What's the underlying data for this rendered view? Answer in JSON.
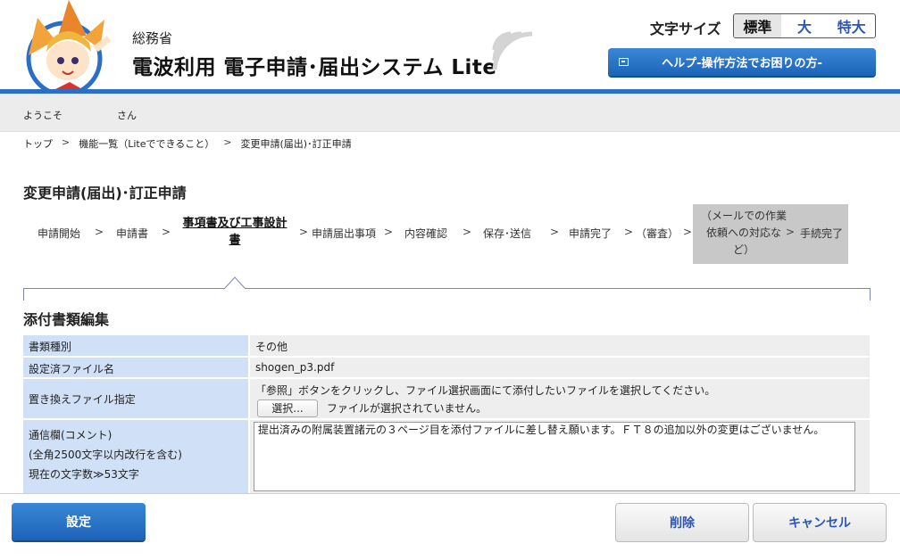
{
  "header": {
    "org_name": "総務省",
    "system_title": "電波利用 電子申請･届出システム Lite",
    "font_size_label": "文字サイズ",
    "font_size_options": [
      "標準",
      "大",
      "特大"
    ],
    "font_size_selected": "標準",
    "help_button": "ヘルプ-操作方法でお困りの方-"
  },
  "welcome": {
    "prefix": "ようこそ",
    "suffix": "さん"
  },
  "breadcrumb": [
    "トップ",
    "機能一覧（Liteでできること）",
    "変更申請(届出)･訂正申請"
  ],
  "page_title": "変更申請(届出)･訂正申請",
  "steps": {
    "s1": "申請開始",
    "s2": "申請書",
    "s3_line1": "事項書及び工事設計",
    "s3_line2": "書",
    "s4": "申請届出事項",
    "s5": "内容確認",
    "s6": "保存･送信",
    "s7": "申請完了",
    "s8": "（審査）",
    "s9_line1": "（メールでの作業",
    "s9_line2": "依頼への対応な",
    "s9_line3": "ど）",
    "s10": "手続完了",
    "current": "事項書及び工事設計書"
  },
  "section_title": "添付書類編集",
  "form": {
    "doc_type_label": "書類種別",
    "doc_type_value": "その他",
    "file_name_label": "設定済ファイル名",
    "file_name_value": "shogen_p3.pdf",
    "replace_label": "置き換えファイル指定",
    "replace_instruction": "「参照」ボタンをクリックし、ファイル選択画面にて添付したいファイルを選択してください。",
    "select_button": "選択...",
    "no_file_text": "ファイルが選択されていません。",
    "comment_label": "通信欄(コメント)",
    "comment_limit": "(全角2500文字以内改行を含む)",
    "comment_count": "現在の文字数≫53文字",
    "comment_value": "提出済みの附属装置諸元の３ページ目を添付ファイルに差し替え願います。ＦＴ８の追加以外の変更はございません。"
  },
  "buttons": {
    "set": "設定",
    "delete": "削除",
    "cancel": "キャンセル"
  },
  "colors": {
    "accent_blue": "#2a6fc5",
    "label_cell": "#cfe0f7",
    "value_cell": "#eeeeee"
  }
}
